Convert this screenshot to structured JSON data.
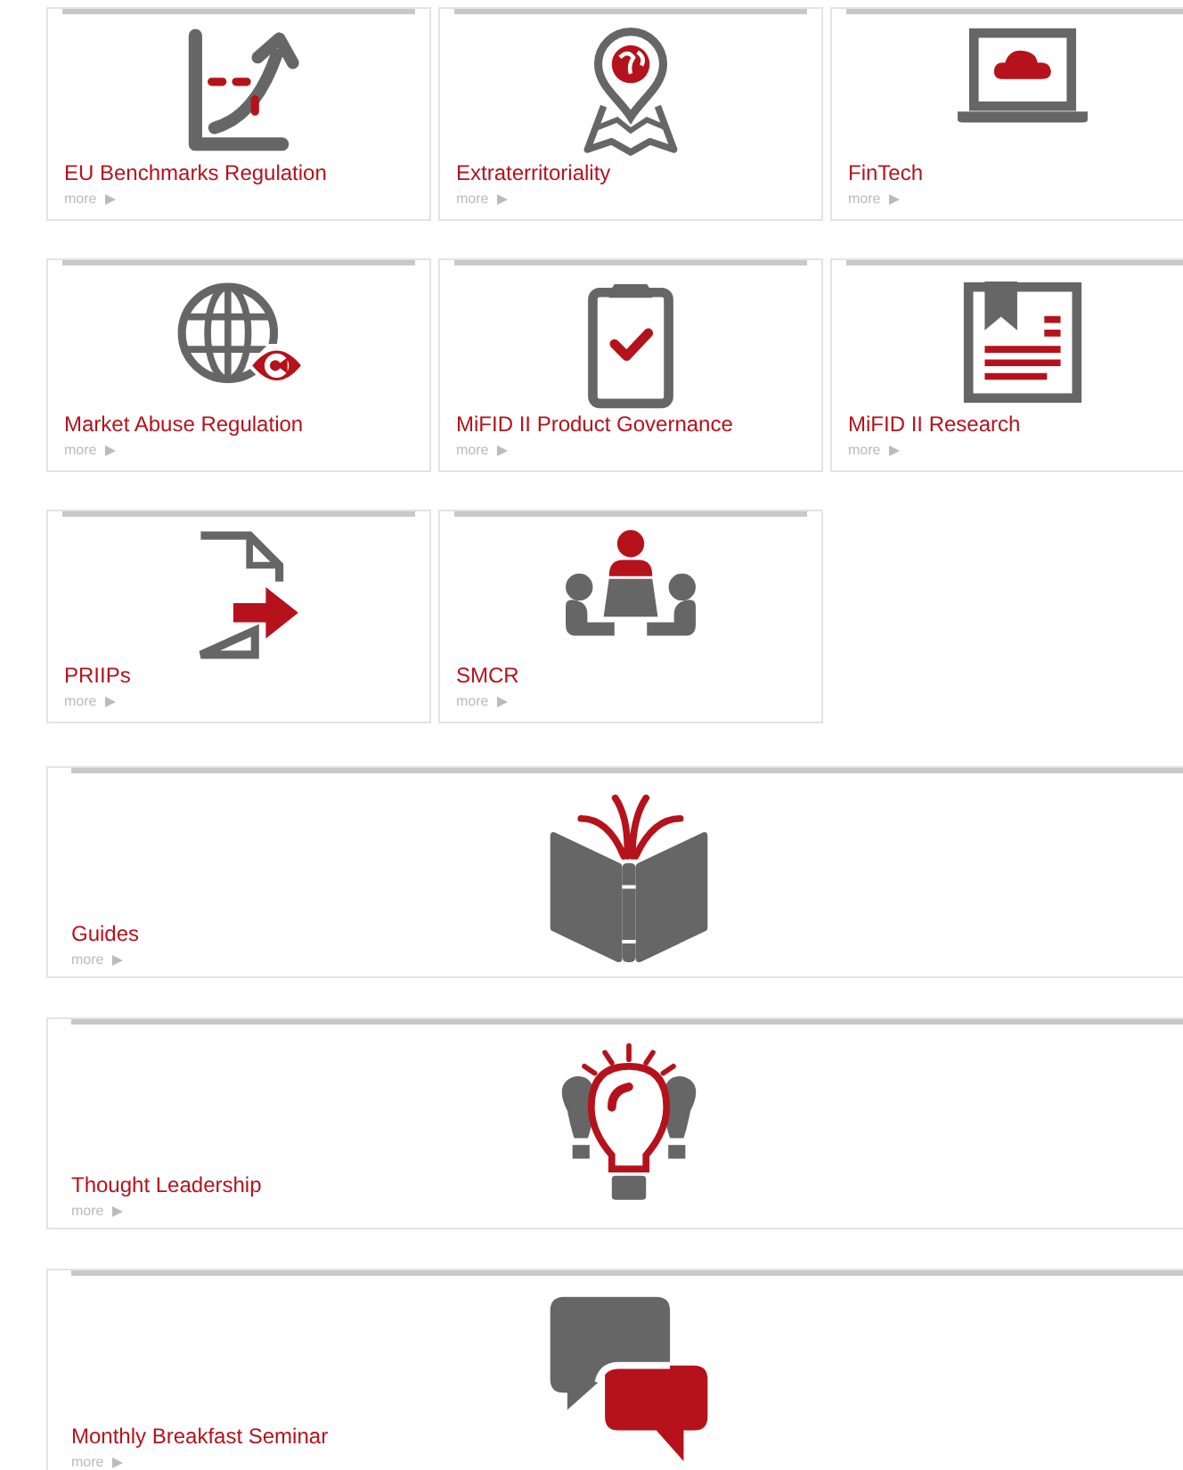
{
  "small_tiles": [
    {
      "title": "EU Benchmarks Regulation",
      "link": "more"
    },
    {
      "title": "Extraterritoriality",
      "link": "more"
    },
    {
      "title": "FinTech",
      "link": "more"
    },
    {
      "title": "Market Abuse Regulation",
      "link": "more"
    },
    {
      "title": "MiFID II Product Governance",
      "link": "more"
    },
    {
      "title": "MiFID II Research",
      "link": "more"
    },
    {
      "title": "PRIIPs",
      "link": "more"
    },
    {
      "title": "SMCR",
      "link": "more"
    }
  ],
  "wide_tiles": [
    {
      "title": "Guides",
      "link": "more"
    },
    {
      "title": "Thought Leadership",
      "link": "more"
    },
    {
      "title": "Monthly Breakfast Seminar",
      "link": "more"
    }
  ]
}
